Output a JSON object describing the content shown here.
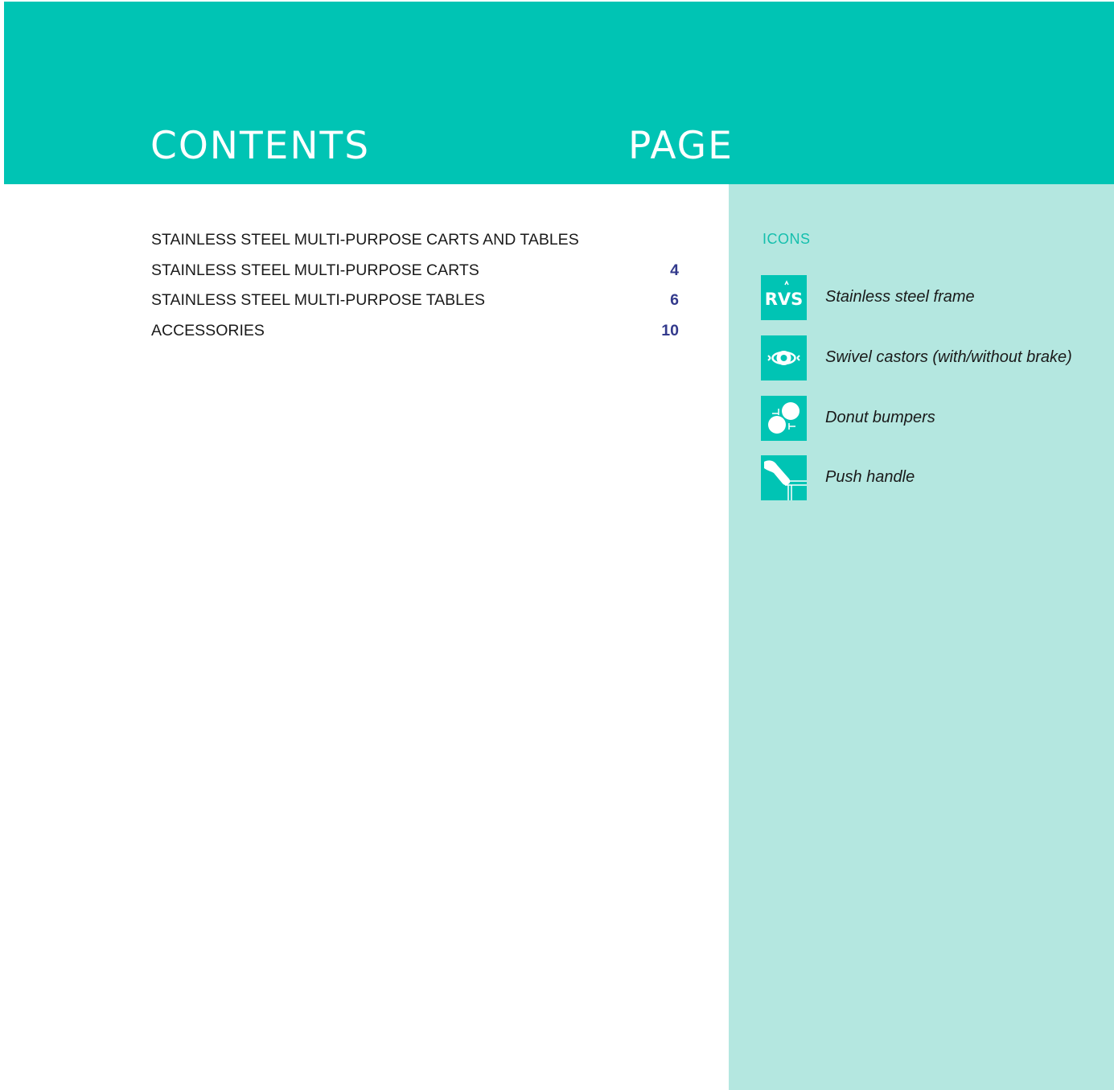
{
  "header": {
    "contents_title": "CONTENTS",
    "page_title": "PAGE"
  },
  "toc": {
    "entries": [
      {
        "label": "STAINLESS STEEL MULTI-PURPOSE CARTS AND TABLES",
        "page": ""
      },
      {
        "label": "STAINLESS STEEL MULTI-PURPOSE CARTS",
        "page": "4"
      },
      {
        "label": "STAINLESS STEEL MULTI-PURPOSE TABLES",
        "page": "6"
      },
      {
        "label": "ACCESSORIES",
        "page": "10"
      }
    ]
  },
  "sidebar": {
    "heading": "ICONS",
    "icons": [
      {
        "icon": "rvs-icon",
        "glyph_text": "RVS",
        "label": "Stainless steel frame"
      },
      {
        "icon": "swivel-castor-icon",
        "label": "Swivel castors (with/without brake)"
      },
      {
        "icon": "donut-bumper-icon",
        "label": "Donut bumpers"
      },
      {
        "icon": "push-handle-icon",
        "label": "Push handle"
      }
    ]
  },
  "colors": {
    "header_bg": "#00c4b4",
    "sidebar_bg": "#b4e7e0",
    "sidebar_heading": "#15bfad",
    "page_number": "#333a8c",
    "icon_bg": "#00c4b4"
  }
}
